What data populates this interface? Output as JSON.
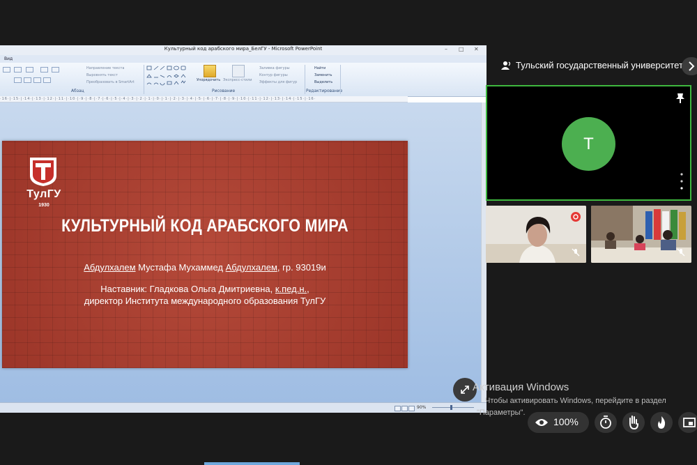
{
  "ppt": {
    "title": "Культурный код арабского мира_БелГУ - Microsoft PowerPoint",
    "menu_view": "Вид",
    "window_controls": {
      "minimize": "–",
      "maximize": "□",
      "close": "✕"
    },
    "ribbon": {
      "group_paragraph": "Абзац",
      "group_drawing": "Рисование",
      "group_editing": "Редактирование",
      "text_direction": "Направление текста",
      "align_text": "Выровнять текст",
      "convert_smartart": "Преобразовать в SmartArt",
      "arrange": "Упорядочить",
      "quick_styles": "Экспресс-стили",
      "shape_fill": "Заливка фигуры",
      "shape_outline": "Контур фигуры",
      "shape_effects": "Эффекты для фигур",
      "find": "Найти",
      "replace": "Заменить",
      "select": "Выделить"
    },
    "ruler_text": "·16·|·15·|·14·|·13·|·12·|·11·|·10·|·9·|·8·|·7·|·6·|·5·|·4·|·3·|·2·|·1·|·0·|·1·|·2·|·3·|·4·|·5·|·6·|·7·|·8·|·9·|·10·|·11·|·12·|·13·|·14·|·15·|·16·",
    "zoom_level": "90%"
  },
  "slide": {
    "logo_text": "ТулГУ",
    "logo_year": "1930",
    "title": "КУЛЬТУРНЫЙ КОД АРАБСКОГО МИРА",
    "author_part1": "Абдулхалем",
    "author_part2": " Мустафа Мухаммед ",
    "author_part3": "Абдулхалем",
    "author_part4": ", гр. 93019и",
    "mentor_part1": "Наставник: Гладкова Ольга Дмитриевна, ",
    "mentor_part2": "к.пед.н.",
    "mentor_part3": ",",
    "mentor_line2": "директор Института международного образования ТулГУ"
  },
  "meeting": {
    "panel_title": "Тульский государственный университет",
    "avatar_letter": "Т",
    "zoom": "100%",
    "colors": {
      "accent_green": "#3fb93f",
      "avatar_green": "#4caf50"
    }
  },
  "windows_activation": {
    "title": "Активация Windows",
    "line1": "Чтобы активировать Windows, перейдите в раздел",
    "line2": "\"Параметры\"."
  }
}
